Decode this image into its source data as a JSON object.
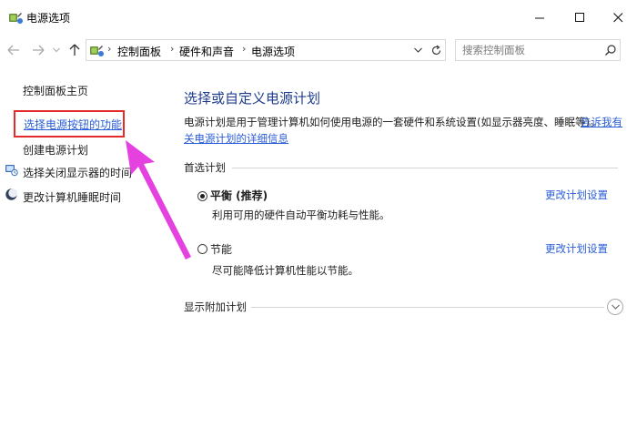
{
  "window": {
    "title": "电源选项"
  },
  "address": {
    "crumbs": [
      "控制面板",
      "硬件和声音",
      "电源选项"
    ]
  },
  "search": {
    "placeholder": "搜索控制面板"
  },
  "sidebar": {
    "items": [
      {
        "label": "控制面板主页"
      },
      {
        "label": "选择电源按钮的功能"
      },
      {
        "label": "创建电源计划"
      },
      {
        "label": "选择关闭显示器的时间",
        "icon": "monitor-clock-icon"
      },
      {
        "label": "更改计算机睡眠时间",
        "icon": "moon-icon"
      }
    ]
  },
  "main": {
    "title": "选择或自定义电源计划",
    "description": "电源计划是用于管理计算机如何使用电源的一套硬件和系统设置(如显示器亮度、睡眠等)。",
    "description_link": "告诉我有",
    "description_link2": "关电源计划的详细信息",
    "preferred_header": "首选计划",
    "plans": [
      {
        "name": "平衡 (推荐)",
        "description": "利用可用的硬件自动平衡功耗与性能。",
        "selected": true,
        "change_label": "更改计划设置"
      },
      {
        "name": "节能",
        "description": "尽可能降低计算机性能以节能。",
        "selected": false,
        "change_label": "更改计划设置"
      }
    ],
    "extra_header": "显示附加计划"
  },
  "colors": {
    "link": "#2a5dd6",
    "title": "#1e3c8c",
    "highlight_border": "#e32b2b",
    "annotation_arrow": "#e540e0"
  }
}
